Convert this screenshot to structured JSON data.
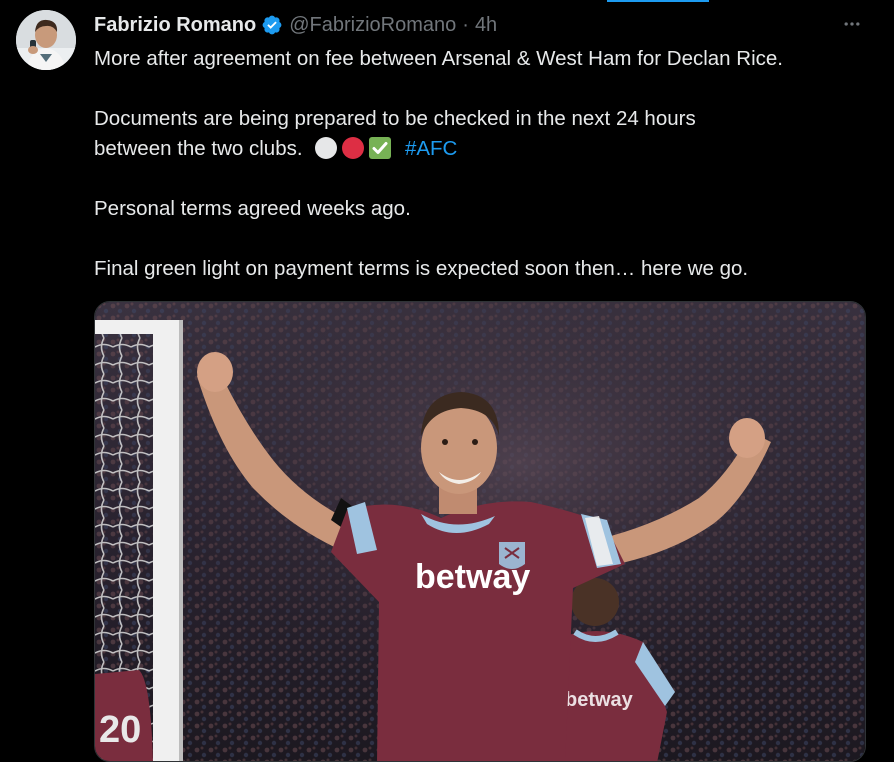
{
  "tweet": {
    "display_name": "Fabrizio Romano",
    "handle": "@FabrizioRomano",
    "separator": "·",
    "time": "4h",
    "more_icon": "more-horizontal-icon",
    "verified_icon": "verified-badge-icon",
    "text": {
      "p1": "More after agreement on fee between Arsenal & West Ham for Declan Rice.",
      "p2_line1": "Documents are being prepared to be checked in the next 24 hours",
      "p2_line2": "between the two clubs.",
      "hashtag": "#AFC",
      "p3": "Personal terms agreed weeks ago.",
      "p4": "Final green light on payment terms is expected soon then… here we go."
    },
    "emojis": [
      "white-circle-icon",
      "red-circle-icon",
      "check-mark-button-icon"
    ],
    "media": {
      "shirt_sponsor": "betway",
      "background_shirt_sponsor": "betway",
      "background_shirt_number": "20"
    }
  },
  "colors": {
    "background": "#000000",
    "text_primary": "#e7e9ea",
    "text_secondary": "#71767b",
    "link": "#1d9bf0",
    "verified": "#1d9bf0",
    "shirt_claret": "#7a2d3e",
    "shirt_sky_blue": "#9fc3e0"
  }
}
